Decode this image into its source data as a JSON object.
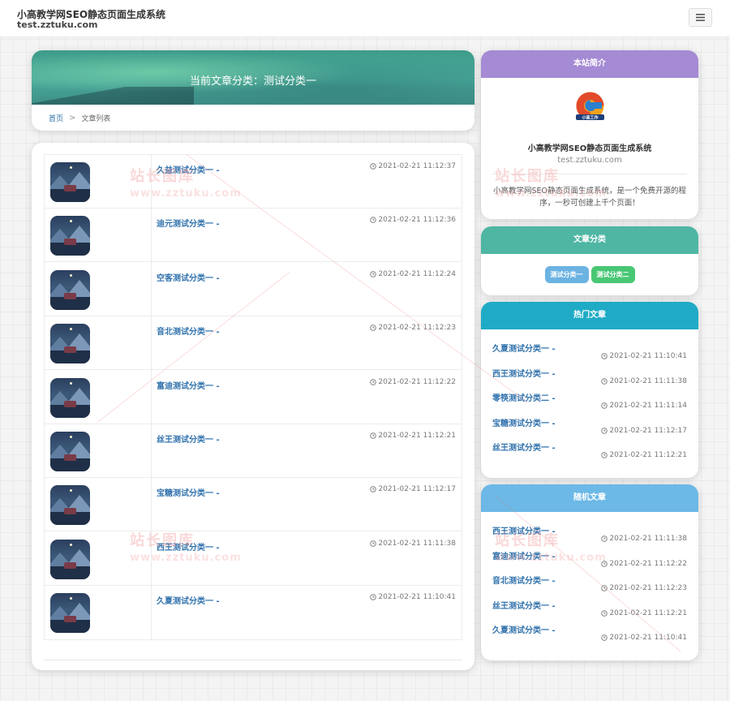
{
  "header": {
    "title": "小高教学网SEO静态页面生成系统",
    "domain": "test.zztuku.com",
    "menu_icon": "menu-icon"
  },
  "banner": {
    "title": "当前文章分类：测试分类一"
  },
  "breadcrumb": {
    "home": "首页",
    "separator": ">",
    "current": "文章列表"
  },
  "articles": [
    {
      "title": "久益测试分类一 -",
      "time": "2021-02-21 11:12:37"
    },
    {
      "title": "迪元测试分类一 -",
      "time": "2021-02-21 11:12:36"
    },
    {
      "title": "空客测试分类一 -",
      "time": "2021-02-21 11:12:24"
    },
    {
      "title": "音北测试分类一 -",
      "time": "2021-02-21 11:12:23"
    },
    {
      "title": "富迪测试分类一 -",
      "time": "2021-02-21 11:12:22"
    },
    {
      "title": "丝王测试分类一 -",
      "time": "2021-02-21 11:12:21"
    },
    {
      "title": "宝糖测试分类一 -",
      "time": "2021-02-21 11:12:17"
    },
    {
      "title": "西王测试分类一 -",
      "time": "2021-02-21 11:11:38"
    },
    {
      "title": "久夏测试分类一 -",
      "time": "2021-02-21 11:10:41"
    }
  ],
  "sidebar": {
    "about": {
      "heading": "本站简介",
      "name": "小高教学网SEO静态页面生成系统",
      "domain": "test.zztuku.com",
      "description": "小高教学网SEO静态页面生成系统，是一个免费开源的程序，一秒可创建上千个页面！",
      "color": "#a58ad4"
    },
    "categories": {
      "heading": "文章分类",
      "color": "#4eb6a3",
      "items": [
        {
          "label": "测试分类一",
          "color": "#6bb3e3"
        },
        {
          "label": "测试分类二",
          "color": "#48c774"
        }
      ]
    },
    "hot": {
      "heading": "热门文章",
      "color": "#1fabc6",
      "items": [
        {
          "title": "久夏测试分类一 -",
          "time": "2021-02-21 11:10:41"
        },
        {
          "title": "西王测试分类一 -",
          "time": "2021-02-21 11:11:38"
        },
        {
          "title": "零筷测试分类二 -",
          "time": "2021-02-21 11:11:14"
        },
        {
          "title": "宝糖测试分类一 -",
          "time": "2021-02-21 11:12:17"
        },
        {
          "title": "丝王测试分类一 -",
          "time": "2021-02-21 11:12:21"
        }
      ]
    },
    "random": {
      "heading": "随机文章",
      "color": "#6cb8e6",
      "items": [
        {
          "title": "西王测试分类一 -",
          "time": "2021-02-21 11:11:38"
        },
        {
          "title": "富迪测试分类一 -",
          "time": "2021-02-21 11:12:22"
        },
        {
          "title": "音北测试分类一 -",
          "time": "2021-02-21 11:12:23"
        },
        {
          "title": "丝王测试分类一 -",
          "time": "2021-02-21 11:12:21"
        },
        {
          "title": "久夏测试分类一 -",
          "time": "2021-02-21 11:10:41"
        }
      ]
    }
  },
  "watermark": {
    "cn": "站长图库",
    "en": "www.zztuku.com"
  }
}
